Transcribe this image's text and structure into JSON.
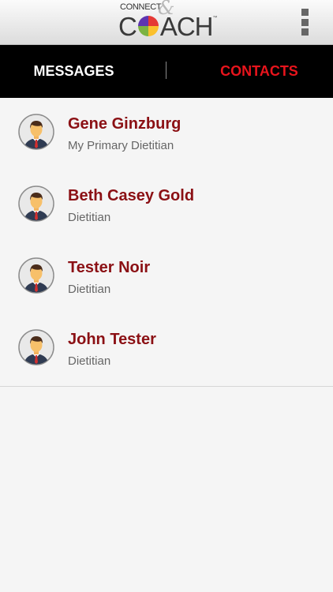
{
  "header": {
    "logo": {
      "connect": "CONNECT",
      "amp": "&",
      "coach_first": "C",
      "coach_rest": "ACH",
      "tm": "™"
    },
    "menu_icon": "more-vertical-icon"
  },
  "tabs": [
    {
      "label": "MESSAGES",
      "active": false
    },
    {
      "label": "CONTACTS",
      "active": true
    }
  ],
  "contacts": [
    {
      "name": "Gene Ginzburg",
      "role": "My Primary Dietitian",
      "avatar_icon": "person-avatar-icon"
    },
    {
      "name": "Beth Casey Gold",
      "role": "Dietitian",
      "avatar_icon": "person-avatar-icon"
    },
    {
      "name": "Tester Noir",
      "role": "Dietitian",
      "avatar_icon": "person-avatar-icon"
    },
    {
      "name": "John Tester",
      "role": "Dietitian",
      "avatar_icon": "person-avatar-icon"
    }
  ],
  "colors": {
    "active_tab": "#e8141c",
    "inactive_tab": "#ffffff",
    "contact_name": "#8b1014",
    "contact_role": "#666666",
    "tab_bar_bg": "#000000",
    "list_bg": "#f5f5f5"
  }
}
